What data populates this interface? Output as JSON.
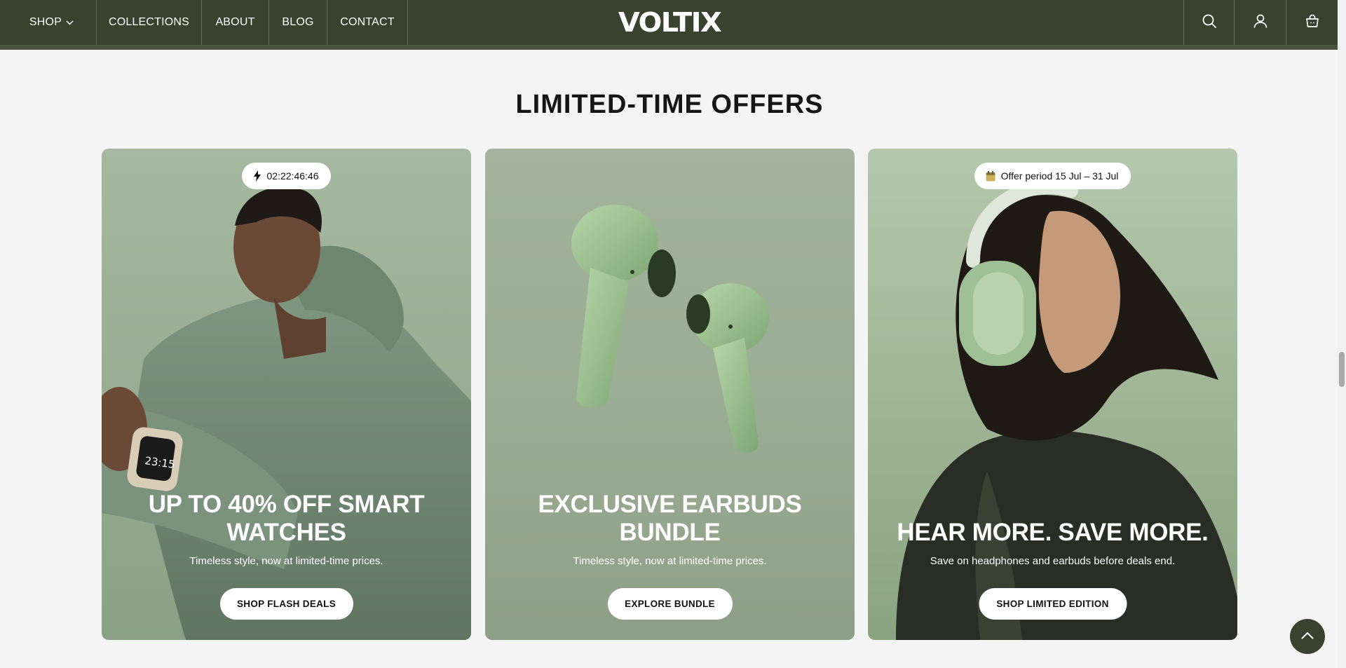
{
  "header": {
    "nav": {
      "shop": "SHOP",
      "collections": "COLLECTIONS",
      "about": "ABOUT",
      "blog": "BLOG",
      "contact": "CONTACT"
    },
    "logo": "VOLTIX",
    "icons": [
      "search-icon",
      "user-icon",
      "cart-icon"
    ]
  },
  "section": {
    "title": "LIMITED-TIME OFFERS"
  },
  "cards": [
    {
      "badge": "02:22:46:46",
      "badge_icon": "lightning-icon",
      "title_line1": "UP TO 40% OFF SMART",
      "title_line2": "WATCHES",
      "subtitle": "Timeless style, now at limited-time prices.",
      "button": "SHOP FLASH DEALS"
    },
    {
      "title_line1": "EXCLUSIVE EARBUDS",
      "title_line2": "BUNDLE",
      "subtitle": "Timeless style, now at limited-time prices.",
      "button": "EXPLORE BUNDLE"
    },
    {
      "badge": "Offer period 15 Jul – 31 Jul",
      "badge_icon": "calendar-icon",
      "title_line1": "HEAR MORE. SAVE MORE.",
      "subtitle": "Save on headphones and earbuds before deals end.",
      "button": "SHOP LIMITED EDITION"
    }
  ],
  "watch_display": "23:15",
  "colors": {
    "header_bg": "#3b412f",
    "page_bg": "#f4f4f4",
    "card_green": "#98ad93"
  }
}
